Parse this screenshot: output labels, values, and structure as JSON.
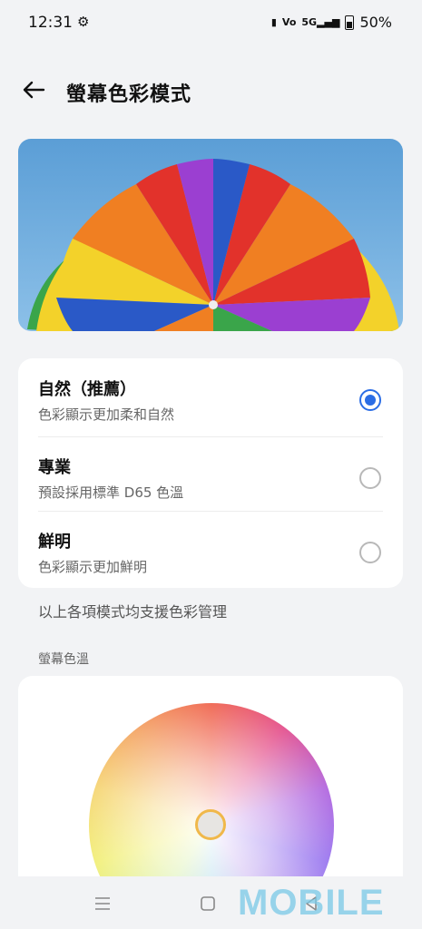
{
  "status_bar": {
    "time": "12:31",
    "battery_percent": "50%",
    "icons": [
      "gear-icon",
      "vibrate-icon",
      "volte-icon",
      "5g-signal-icon",
      "battery-icon"
    ]
  },
  "header": {
    "title": "螢幕色彩模式",
    "back_icon": "arrow-left-icon"
  },
  "modes": [
    {
      "title": "自然（推薦）",
      "subtitle": "色彩顯示更加柔和自然",
      "selected": true
    },
    {
      "title": "專業",
      "subtitle": "預設採用標準 D65 色溫",
      "selected": false
    },
    {
      "title": "鮮明",
      "subtitle": "色彩顯示更加鮮明",
      "selected": false
    }
  ],
  "note": "以上各項模式均支援色彩管理",
  "color_temperature": {
    "label": "螢幕色溫"
  },
  "nav_bar": {
    "icons": [
      "menu-icon",
      "home-square-icon",
      "back-triangle-icon"
    ]
  },
  "watermark": "MOBILE",
  "colors": {
    "accent": "#2b6de5",
    "background": "#f2f3f5",
    "card": "#ffffff",
    "handle_ring": "#f0b84a"
  }
}
